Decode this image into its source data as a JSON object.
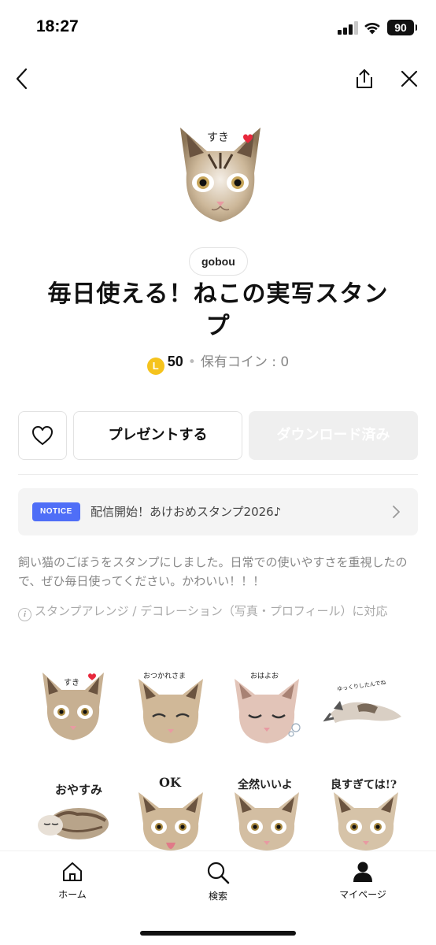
{
  "status": {
    "time": "18:27",
    "battery": "90"
  },
  "icons": {
    "back": "chevron-left-icon",
    "share": "share-icon",
    "close": "close-icon",
    "like": "heart-icon",
    "coin": "line-coin-icon",
    "info": "info-icon",
    "home": "home-icon",
    "search": "search-icon",
    "mypage": "person-icon"
  },
  "product": {
    "hero_caption": "すき",
    "creator": "gobou",
    "title": "毎日使える！ねこの実写スタンプ",
    "coin_letter": "L",
    "price": "50",
    "owned_coins": "保有コイン : 0"
  },
  "actions": {
    "present_label": "プレゼントする",
    "download_label": "ダウンロード済み"
  },
  "notice": {
    "badge": "NOTICE",
    "text": "配信開始！あけおめスタンプ2026♪"
  },
  "description": "飼い猫のごぼうをスタンプにしました。日常での使いやすさを重視したので、ぜひ毎日使ってください。かわいい！！！",
  "feature_note": "スタンプアレンジ / デコレーション（写真・プロフィール）に対応",
  "stickers": [
    {
      "caption": "すき"
    },
    {
      "caption": "おつかれさま"
    },
    {
      "caption": "おはよお"
    },
    {
      "caption": "ゆっくりしたんでね"
    },
    {
      "caption": "おやすみ"
    },
    {
      "caption": "OK"
    },
    {
      "caption": "全然いいよ"
    },
    {
      "caption": "良すぎては!?"
    }
  ],
  "tabs": [
    {
      "label": "ホーム"
    },
    {
      "label": "検索"
    },
    {
      "label": "マイページ"
    }
  ],
  "colors": {
    "notice_badge": "#4f6ef7",
    "coin": "#f5c31d",
    "heart": "#e8283c",
    "download_disabled_bg": "#efefef"
  }
}
